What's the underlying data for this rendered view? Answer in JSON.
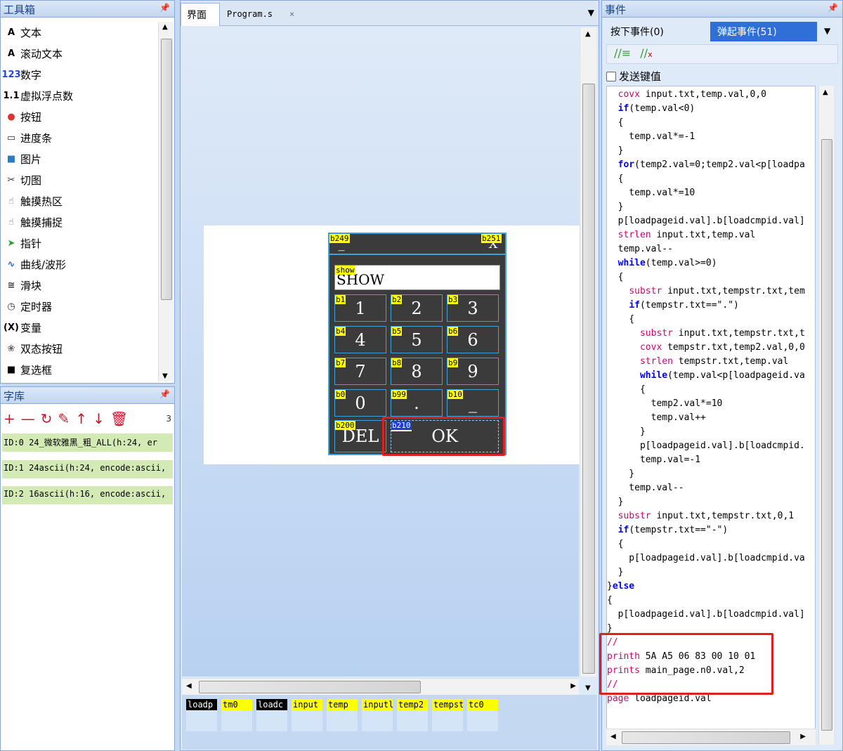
{
  "toolbox": {
    "title": "工具箱",
    "pin": "❘",
    "items": [
      {
        "icon": "A",
        "label": "文本"
      },
      {
        "icon": "A",
        "label": "滚动文本"
      },
      {
        "icon": "123",
        "label": "数字"
      },
      {
        "icon": "1.1",
        "label": "虚拟浮点数"
      },
      {
        "icon": "●",
        "label": "按钮"
      },
      {
        "icon": "▭",
        "label": "进度条"
      },
      {
        "icon": "■",
        "label": "图片"
      },
      {
        "icon": "✂",
        "label": "切图"
      },
      {
        "icon": "☝",
        "label": "触摸热区"
      },
      {
        "icon": "☝",
        "label": "触摸捕捉"
      },
      {
        "icon": "➤",
        "label": "指针"
      },
      {
        "icon": "∿",
        "label": "曲线/波形"
      },
      {
        "icon": "≅",
        "label": "滑块"
      },
      {
        "icon": "◷",
        "label": "定时器"
      },
      {
        "icon": "(X)",
        "label": "变量"
      },
      {
        "icon": "❀",
        "label": "双态按钮"
      },
      {
        "icon": "■",
        "label": "复选框"
      }
    ]
  },
  "fontlib": {
    "title": "字库",
    "count": "3",
    "rows": [
      "ID:0  24_微软雅黑_粗_ALL(h:24, er",
      "ID:1  24ascii(h:24, encode:ascii,",
      "ID:2  16ascii(h:16, encode:ascii,"
    ]
  },
  "center": {
    "tabs": [
      "界面",
      "Program.s"
    ],
    "close": "×",
    "dropdown": "▼",
    "device": {
      "b249": "b249",
      "b251": "b251",
      "b249_text": "_",
      "b251_text": "X",
      "show_label": "show",
      "show_text": "SHOW",
      "keys": [
        {
          "id": "b1",
          "t": "1"
        },
        {
          "id": "b2",
          "t": "2"
        },
        {
          "id": "b3",
          "t": "3"
        },
        {
          "id": "b4",
          "t": "4"
        },
        {
          "id": "b5",
          "t": "5"
        },
        {
          "id": "b6",
          "t": "6"
        },
        {
          "id": "b7",
          "t": "7"
        },
        {
          "id": "b8",
          "t": "8"
        },
        {
          "id": "b9",
          "t": "9"
        },
        {
          "id": "b0",
          "t": "0"
        },
        {
          "id": "b99",
          "t": "."
        },
        {
          "id": "b10",
          "t": "_"
        }
      ],
      "del_id": "b200",
      "del": "DEL",
      "ok_id": "b210",
      "ok": "OK"
    },
    "vars": [
      {
        "n": "loadp",
        "dark": true
      },
      {
        "n": "tm0",
        "dark": false
      },
      {
        "n": "loadc",
        "dark": true
      },
      {
        "n": "input",
        "dark": false
      },
      {
        "n": "temp",
        "dark": false
      },
      {
        "n": "inputl",
        "dark": false
      },
      {
        "n": "temp2",
        "dark": false
      },
      {
        "n": "tempst",
        "dark": false
      },
      {
        "n": "tc0",
        "dark": false
      }
    ]
  },
  "events": {
    "title": "事件",
    "tab_press": "按下事件(0)",
    "tab_release": "弹起事件(51)",
    "send_key": "发送键值",
    "lines": [
      [
        [
          "  ",
          ""
        ],
        [
          "covx",
          "fn"
        ],
        [
          " input.txt,temp.val,0,0",
          ""
        ]
      ],
      [
        [
          "  ",
          ""
        ],
        [
          "if",
          "kw"
        ],
        [
          "(temp.val<0)",
          ""
        ]
      ],
      [
        [
          "  {",
          ""
        ]
      ],
      [
        [
          "    temp.val*=-1",
          ""
        ]
      ],
      [
        [
          "  }",
          ""
        ]
      ],
      [
        [
          "  ",
          ""
        ],
        [
          "for",
          "kw"
        ],
        [
          "(temp2.val=0;temp2.val<p[loadpa",
          ""
        ]
      ],
      [
        [
          "  {",
          ""
        ]
      ],
      [
        [
          "    temp.val*=10",
          ""
        ]
      ],
      [
        [
          "  }",
          ""
        ]
      ],
      [
        [
          "  p[loadpageid.val].b[loadcmpid.val]",
          ""
        ]
      ],
      [
        [
          "  ",
          ""
        ],
        [
          "strlen",
          "fn"
        ],
        [
          " input.txt,temp.val",
          ""
        ]
      ],
      [
        [
          "  temp.val--",
          ""
        ]
      ],
      [
        [
          "  ",
          ""
        ],
        [
          "while",
          "kw"
        ],
        [
          "(temp.val>=0)",
          ""
        ]
      ],
      [
        [
          "  {",
          ""
        ]
      ],
      [
        [
          "    ",
          ""
        ],
        [
          "substr",
          "fn"
        ],
        [
          " input.txt,tempstr.txt,tem",
          ""
        ]
      ],
      [
        [
          "    ",
          ""
        ],
        [
          "if",
          "kw"
        ],
        [
          "(tempstr.txt==\".\")",
          ""
        ]
      ],
      [
        [
          "    {",
          ""
        ]
      ],
      [
        [
          "      ",
          ""
        ],
        [
          "substr",
          "fn"
        ],
        [
          " input.txt,tempstr.txt,t",
          ""
        ]
      ],
      [
        [
          "      ",
          ""
        ],
        [
          "covx",
          "fn"
        ],
        [
          " tempstr.txt,temp2.val,0,0",
          ""
        ]
      ],
      [
        [
          "      ",
          ""
        ],
        [
          "strlen",
          "fn"
        ],
        [
          " tempstr.txt,temp.val",
          ""
        ]
      ],
      [
        [
          "      ",
          ""
        ],
        [
          "while",
          "kw"
        ],
        [
          "(temp.val<p[loadpageid.va",
          ""
        ]
      ],
      [
        [
          "      {",
          ""
        ]
      ],
      [
        [
          "        temp2.val*=10",
          ""
        ]
      ],
      [
        [
          "        temp.val++",
          ""
        ]
      ],
      [
        [
          "      }",
          ""
        ]
      ],
      [
        [
          "      p[loadpageid.val].b[loadcmpid.",
          ""
        ]
      ],
      [
        [
          "      temp.val=-1",
          ""
        ]
      ],
      [
        [
          "    }",
          ""
        ]
      ],
      [
        [
          "    temp.val--",
          ""
        ]
      ],
      [
        [
          "  }",
          ""
        ]
      ],
      [
        [
          "  ",
          ""
        ],
        [
          "substr",
          "fn"
        ],
        [
          " input.txt,tempstr.txt,0,1",
          ""
        ]
      ],
      [
        [
          "  ",
          ""
        ],
        [
          "if",
          "kw"
        ],
        [
          "(tempstr.txt==\"-\")",
          ""
        ]
      ],
      [
        [
          "  {",
          ""
        ]
      ],
      [
        [
          "    p[loadpageid.val].b[loadcmpid.va",
          ""
        ]
      ],
      [
        [
          "  }",
          ""
        ]
      ],
      [
        [
          "}",
          ""
        ],
        [
          "else",
          "kw"
        ]
      ],
      [
        [
          "{",
          ""
        ]
      ],
      [
        [
          "  p[loadpageid.val].b[loadcmpid.val]",
          ""
        ]
      ],
      [
        [
          "}",
          ""
        ]
      ],
      [
        [
          "//",
          "fn"
        ]
      ],
      [
        [
          "printh",
          "fn"
        ],
        [
          " 5A A5 06 83 00 10 01",
          ""
        ]
      ],
      [
        [
          "prints",
          "fn"
        ],
        [
          " main_page.n0.val,2",
          ""
        ]
      ],
      [
        [
          "//",
          "fn"
        ]
      ],
      [
        [
          "page",
          "fn"
        ],
        [
          " loadpageid.val",
          ""
        ]
      ]
    ]
  }
}
